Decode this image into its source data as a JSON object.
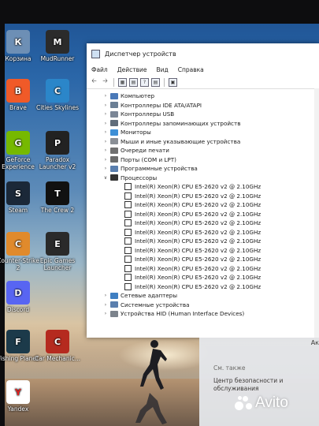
{
  "desktop_icons": [
    {
      "label": "Корзина",
      "icon": "recycle-bin-icon",
      "color": "#6d8fb5"
    },
    {
      "label": "MudRunner",
      "icon": "mudrunner-icon",
      "color": "#2b2b2b"
    },
    {
      "label": "Brave",
      "icon": "brave-icon",
      "color": "#f05a28"
    },
    {
      "label": "Cities Skylines",
      "icon": "cities-skylines-icon",
      "color": "#2b86c9"
    },
    {
      "label": "GeForce Experience",
      "icon": "geforce-icon",
      "color": "#76b900"
    },
    {
      "label": "Paradox Launcher v2",
      "icon": "paradox-icon",
      "color": "#222222"
    },
    {
      "label": "Steam",
      "icon": "steam-icon",
      "color": "#1b2838"
    },
    {
      "label": "The Crew 2",
      "icon": "the-crew-icon",
      "color": "#111111"
    },
    {
      "label": "Counter-Strike 2",
      "icon": "counter-strike-icon",
      "color": "#e08a2c"
    },
    {
      "label": "Epic Games Launcher",
      "icon": "epic-games-icon",
      "color": "#2a2a2a"
    },
    {
      "label": "Discord",
      "icon": "discord-icon",
      "color": "#5865f2"
    },
    {
      "label": "Fishing Planet",
      "icon": "fishing-planet-icon",
      "color": "#1c3a4a"
    },
    {
      "label": "Car Mechanic...",
      "icon": "car-mechanic-icon",
      "color": "#b52a1f"
    },
    {
      "label": "Yandex",
      "icon": "yandex-icon",
      "color": "#ffffff"
    }
  ],
  "window": {
    "title": "Диспетчер устройств",
    "menu": [
      "Файл",
      "Действие",
      "Вид",
      "Справка"
    ],
    "categories": [
      {
        "label": "Компьютер",
        "expanded": false,
        "icon": "computer-icon",
        "color": "#4a79b8"
      },
      {
        "label": "Контроллеры IDE ATA/ATAPI",
        "expanded": false,
        "icon": "ide-controller-icon",
        "color": "#6b7f95"
      },
      {
        "label": "Контроллеры USB",
        "expanded": false,
        "icon": "usb-controller-icon",
        "color": "#7a8696"
      },
      {
        "label": "Контроллеры запоминающих устройств",
        "expanded": false,
        "icon": "storage-controller-icon",
        "color": "#5f6c7a"
      },
      {
        "label": "Мониторы",
        "expanded": false,
        "icon": "monitor-icon",
        "color": "#3d8fd6"
      },
      {
        "label": "Мыши и иные указывающие устройства",
        "expanded": false,
        "icon": "mouse-icon",
        "color": "#8a8f96"
      },
      {
        "label": "Очереди печати",
        "expanded": false,
        "icon": "printer-icon",
        "color": "#707070"
      },
      {
        "label": "Порты (COM и LPT)",
        "expanded": false,
        "icon": "port-icon",
        "color": "#6b6b6b"
      },
      {
        "label": "Программные устройства",
        "expanded": false,
        "icon": "software-device-icon",
        "color": "#5a7fae"
      },
      {
        "label": "Процессоры",
        "expanded": true,
        "icon": "processor-icon",
        "color": "#333333"
      }
    ],
    "processors": [
      "Intel(R) Xeon(R) CPU E5-2620 v2 @ 2.10GHz",
      "Intel(R) Xeon(R) CPU E5-2620 v2 @ 2.10GHz",
      "Intel(R) Xeon(R) CPU E5-2620 v2 @ 2.10GHz",
      "Intel(R) Xeon(R) CPU E5-2620 v2 @ 2.10GHz",
      "Intel(R) Xeon(R) CPU E5-2620 v2 @ 2.10GHz",
      "Intel(R) Xeon(R) CPU E5-2620 v2 @ 2.10GHz",
      "Intel(R) Xeon(R) CPU E5-2620 v2 @ 2.10GHz",
      "Intel(R) Xeon(R) CPU E5-2620 v2 @ 2.10GHz",
      "Intel(R) Xeon(R) CPU E5-2620 v2 @ 2.10GHz",
      "Intel(R) Xeon(R) CPU E5-2620 v2 @ 2.10GHz",
      "Intel(R) Xeon(R) CPU E5-2620 v2 @ 2.10GHz",
      "Intel(R) Xeon(R) CPU E5-2620 v2 @ 2.10GHz"
    ],
    "after": [
      {
        "label": "Сетевые адаптеры",
        "expanded": false,
        "icon": "network-adapter-icon",
        "color": "#3f7fc2"
      },
      {
        "label": "Системные устройства",
        "expanded": false,
        "icon": "system-device-icon",
        "color": "#5a7fae"
      },
      {
        "label": "Устройства HID (Human Interface Devices)",
        "expanded": false,
        "icon": "hid-device-icon",
        "color": "#7c838c"
      }
    ]
  },
  "side_panel": {
    "edge_text": "Ак",
    "see_also": "См. также",
    "link": "Центр безопасности и обслуживания"
  },
  "watermark": "Avito"
}
